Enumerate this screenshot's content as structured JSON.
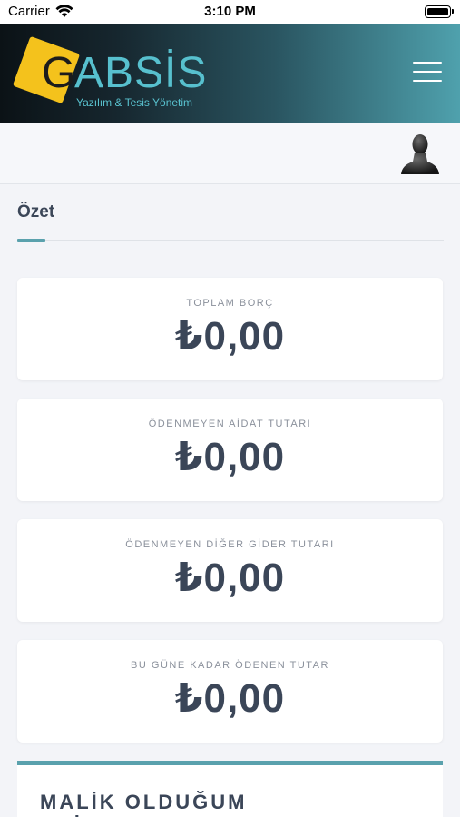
{
  "status_bar": {
    "carrier": "Carrier",
    "time": "3:10 PM"
  },
  "header": {
    "logo_initial": "G",
    "logo_rest": "ABSİS",
    "logo_subtitle": "Yazılım & Tesis Yönetim",
    "accent_color": "#5aa1ad",
    "logo_yellow": "#f4c21c"
  },
  "summary": {
    "title": "Özet",
    "cards": [
      {
        "label": "TOPLAM BORÇ",
        "value": "₺0,00"
      },
      {
        "label": "ÖDENMEYEN AİDAT TUTARI",
        "value": "₺0,00"
      },
      {
        "label": "ÖDENMEYEN DİĞER GİDER TUTARI",
        "value": "₺0,00"
      },
      {
        "label": "BU GÜNE KADAR ÖDENEN TUTAR",
        "value": "₺0,00"
      }
    ]
  },
  "properties": {
    "title": "MALİK OLDUĞUM DAİRELER"
  },
  "icons": {
    "menu": "hamburger-menu-icon",
    "user": "user-silhouette-icon",
    "wifi": "wifi-icon",
    "battery": "battery-icon"
  }
}
